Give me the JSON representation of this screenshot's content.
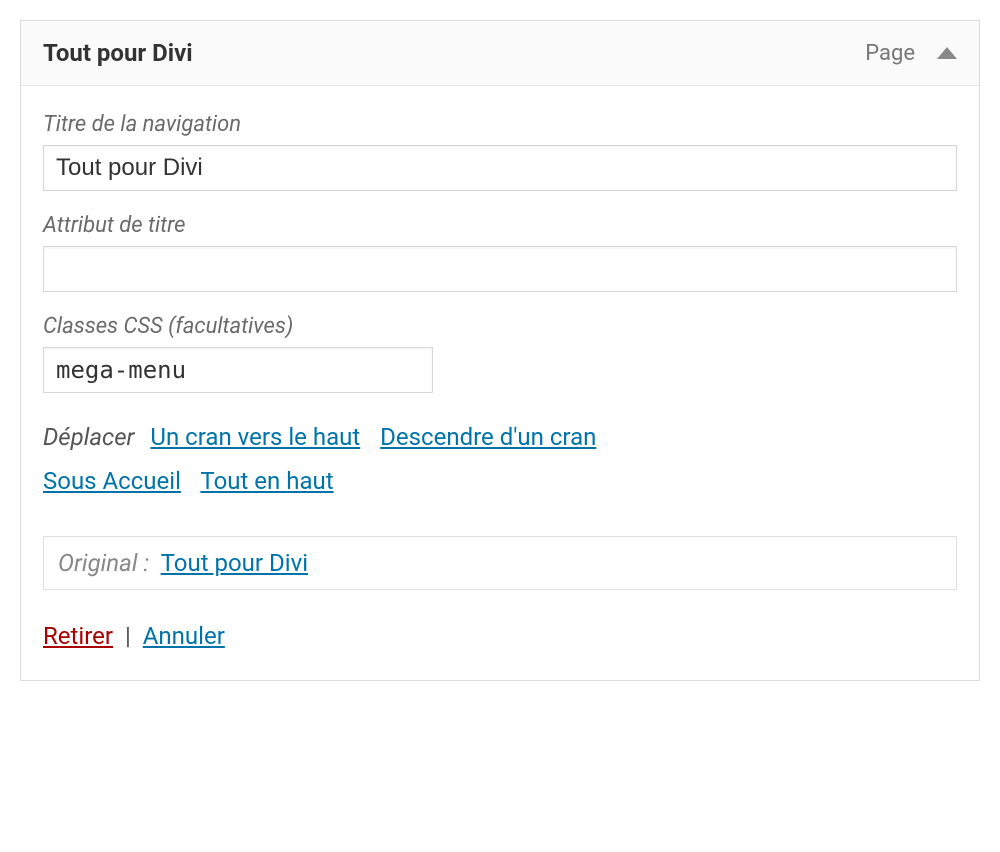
{
  "header": {
    "title": "Tout pour Divi",
    "type": "Page"
  },
  "fields": {
    "nav_label": {
      "label": "Titre de la navigation",
      "value": "Tout pour Divi"
    },
    "title_attr": {
      "label": "Attribut de titre",
      "value": ""
    },
    "css_classes": {
      "label": "Classes CSS (facultatives)",
      "value": "mega-menu"
    }
  },
  "move": {
    "label": "Déplacer",
    "up": "Un cran vers le haut",
    "down": "Descendre d'un cran",
    "under": "Sous Accueil",
    "top": "Tout en haut"
  },
  "original": {
    "label": "Original :",
    "link": "Tout pour Divi"
  },
  "actions": {
    "remove": "Retirer",
    "separator": "|",
    "cancel": "Annuler"
  }
}
